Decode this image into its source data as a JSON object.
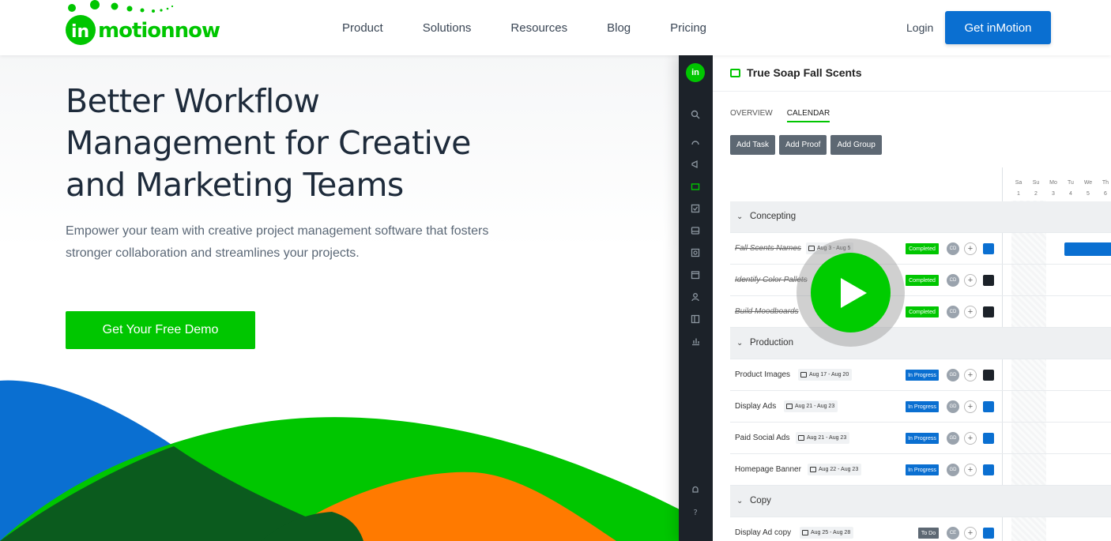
{
  "header": {
    "logo_text": "inmotionnow",
    "nav": [
      "Product",
      "Solutions",
      "Resources",
      "Blog",
      "Pricing"
    ],
    "login": "Login",
    "cta": "Get inMotion"
  },
  "hero": {
    "headline": "Better Workflow Management for Creative and Marketing Teams",
    "subtext": "Empower your team with creative project management software that fosters stronger collaboration and streamlines your projects.",
    "demo_button": "Get Your Free Demo"
  },
  "colors": {
    "brand_green": "#00c600",
    "brand_blue": "#0a6fd1",
    "wave_orange": "#ff7a00",
    "wave_dark_green": "#0b5b1e",
    "sidebar_dark": "#1c2229"
  },
  "app": {
    "logo": "in",
    "project_title": "True Soap Fall Scents",
    "tabs": [
      "OVERVIEW",
      "CALENDAR"
    ],
    "active_tab": "CALENDAR",
    "actions": [
      "Add Task",
      "Add Proof",
      "Add Group"
    ],
    "calendar_days": [
      "Sa",
      "Su",
      "Mo",
      "Tu",
      "We",
      "Th"
    ],
    "calendar_dates": [
      "1",
      "2",
      "3",
      "4",
      "5",
      "6"
    ],
    "sidebar_icons": [
      "search-icon",
      "gauge-icon",
      "megaphone-icon",
      "folder-icon",
      "task-icon",
      "inbox-icon",
      "proof-icon",
      "calendar-icon",
      "person-icon",
      "layout-icon",
      "chart-icon",
      "bell-icon",
      "help-icon"
    ],
    "groups": [
      {
        "name": "Concepting",
        "tasks": [
          {
            "name": "Fall Scents Names",
            "date": "Aug 3 - Aug 5",
            "status": "Completed",
            "avatar": "CD",
            "icon": "task-icon",
            "done": true
          },
          {
            "name": "Identify Color Pallets",
            "date": "",
            "status": "Completed",
            "avatar": "CD",
            "icon": "proof-icon",
            "done": true
          },
          {
            "name": "Build Moodboards",
            "date": "",
            "status": "Completed",
            "avatar": "CD",
            "icon": "proof-icon",
            "done": true
          }
        ]
      },
      {
        "name": "Production",
        "tasks": [
          {
            "name": "Product Images",
            "date": "Aug 17 - Aug 20",
            "status": "In Progress",
            "avatar": "GD",
            "icon": "proof-icon"
          },
          {
            "name": "Display Ads",
            "date": "Aug 21 - Aug 23",
            "status": "In Progress",
            "avatar": "GD",
            "icon": "task-icon"
          },
          {
            "name": "Paid Social Ads",
            "date": "Aug 21 - Aug 23",
            "status": "In Progress",
            "avatar": "GD",
            "icon": "task-icon"
          },
          {
            "name": "Homepage Banner",
            "date": "Aug 22 - Aug 23",
            "status": "In Progress",
            "avatar": "GD",
            "icon": "task-icon"
          }
        ]
      },
      {
        "name": "Copy",
        "tasks": [
          {
            "name": "Display Ad copy",
            "date": "Aug 25 - Aug 28",
            "status": "To Do",
            "avatar": "CE",
            "icon": "task-icon"
          }
        ]
      }
    ]
  },
  "video": {
    "play_icon": "play-icon"
  }
}
